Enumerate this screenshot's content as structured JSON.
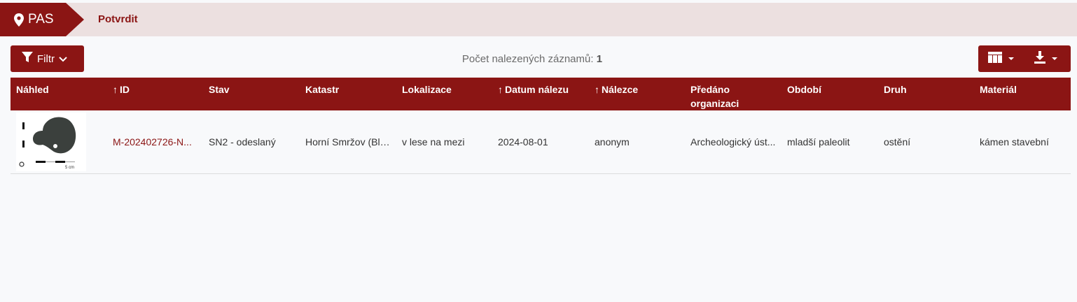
{
  "nav": {
    "brand": "PAS",
    "breadcrumb": "Potvrdit"
  },
  "toolbar": {
    "filter_label": "Filtr",
    "count_label": "Počet nalezených záznamů:",
    "count_value": "1"
  },
  "colors": {
    "accent": "#8b1514",
    "topbar_bg": "#ece0e0",
    "page_bg": "#f8f9fb"
  },
  "table": {
    "columns": [
      {
        "label": "Náhled",
        "sortable": false
      },
      {
        "label": "ID",
        "sortable": true
      },
      {
        "label": "Stav",
        "sortable": false
      },
      {
        "label": "Katastr",
        "sortable": false
      },
      {
        "label": "Lokalizace",
        "sortable": false
      },
      {
        "label": "Datum nálezu",
        "sortable": true
      },
      {
        "label": "Nálezce",
        "sortable": true
      },
      {
        "label": "Předáno organizaci",
        "sortable": false
      },
      {
        "label": "Období",
        "sortable": false
      },
      {
        "label": "Druh",
        "sortable": false
      },
      {
        "label": "Materiál",
        "sortable": false
      }
    ],
    "rows": [
      {
        "thumbnail_scale": "5 cm",
        "id": "M-202402726-N...",
        "stav": "SN2 - odeslaný",
        "katastr": "Horní Smržov (Bla...",
        "lokalizace": "v lese na mezi",
        "datum": "2024-08-01",
        "nalezce": "anonym",
        "predano": "Archeologický úst...",
        "obdobi": "mladší paleolit",
        "druh": "ostění",
        "material": "kámen stavební"
      }
    ]
  }
}
